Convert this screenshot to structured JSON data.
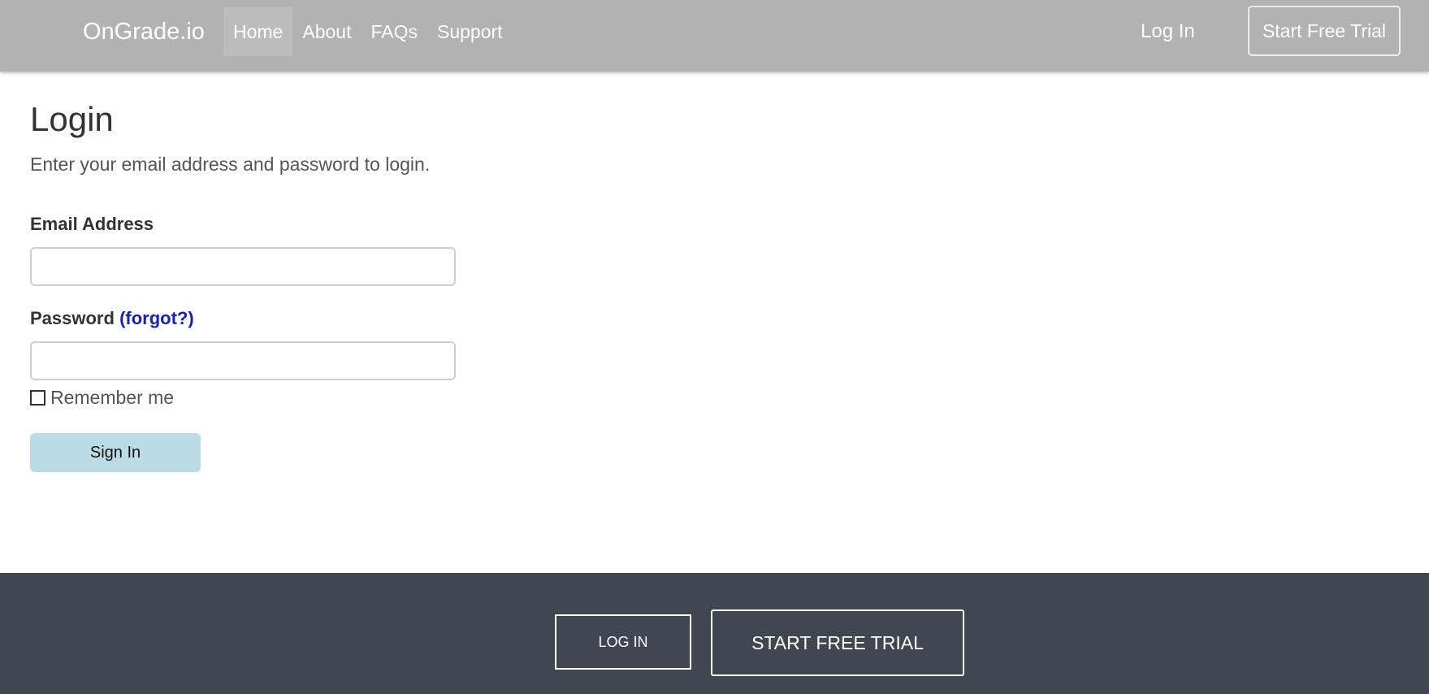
{
  "navbar": {
    "brand": "OnGrade.io",
    "links": [
      {
        "label": "Home",
        "active": true
      },
      {
        "label": "About",
        "active": false
      },
      {
        "label": "FAQs",
        "active": false
      },
      {
        "label": "Support",
        "active": false
      }
    ],
    "login_label": "Log In",
    "trial_label": "Start Free Trial"
  },
  "login": {
    "title": "Login",
    "subtitle": "Enter your email address and password to login.",
    "email_label": "Email Address",
    "email_value": "",
    "password_label": "Password",
    "forgot_label": "(forgot?)",
    "password_value": "",
    "remember_label": "Remember me",
    "remember_checked": false,
    "signin_label": "Sign In"
  },
  "footer": {
    "login_label": "LOG IN",
    "trial_label": "START FREE TRIAL"
  },
  "colors": {
    "navbar_bg": "#b2b2b2",
    "footer_bg": "#424651",
    "signin_bg": "#bbdce6",
    "link": "#1523b5"
  }
}
